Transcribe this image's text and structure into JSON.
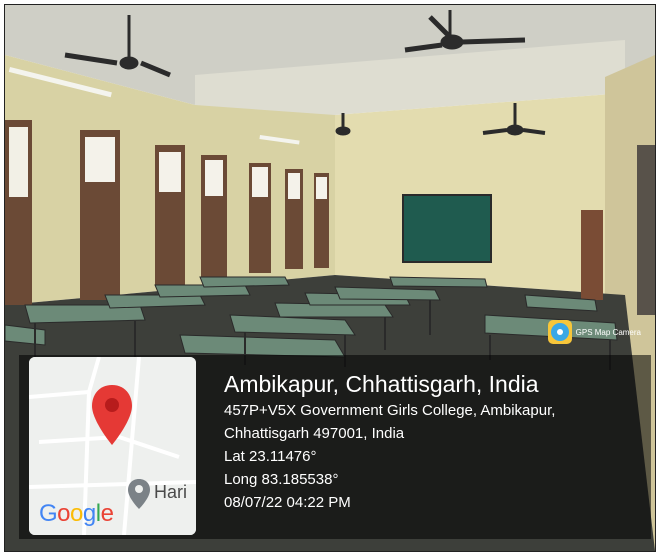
{
  "photo_description_icon": "classroom-scene",
  "camera_app_label": "GPS Map Camera",
  "camera_icon": "gps-map-camera-icon",
  "map": {
    "logo_letters": [
      "G",
      "o",
      "o",
      "g",
      "l",
      "e"
    ],
    "logo_colors": [
      "#4285F4",
      "#EA4335",
      "#FBBC05",
      "#4285F4",
      "#34A853",
      "#EA4335"
    ],
    "street_label": "Hari",
    "pin_icon": "map-pin-icon",
    "pin_color": "#e53935",
    "place_icon": "location-marker-icon"
  },
  "location": {
    "city_line": "Ambikapur, Chhattisgarh, India",
    "address_line1": "457P+V5X Government Girls College, Ambikapur,",
    "address_line2": "Chhattisgarh 497001, India",
    "lat": "Lat 23.11476°",
    "long": "Long 83.185538°",
    "datetime": "08/07/22 04:22 PM"
  }
}
